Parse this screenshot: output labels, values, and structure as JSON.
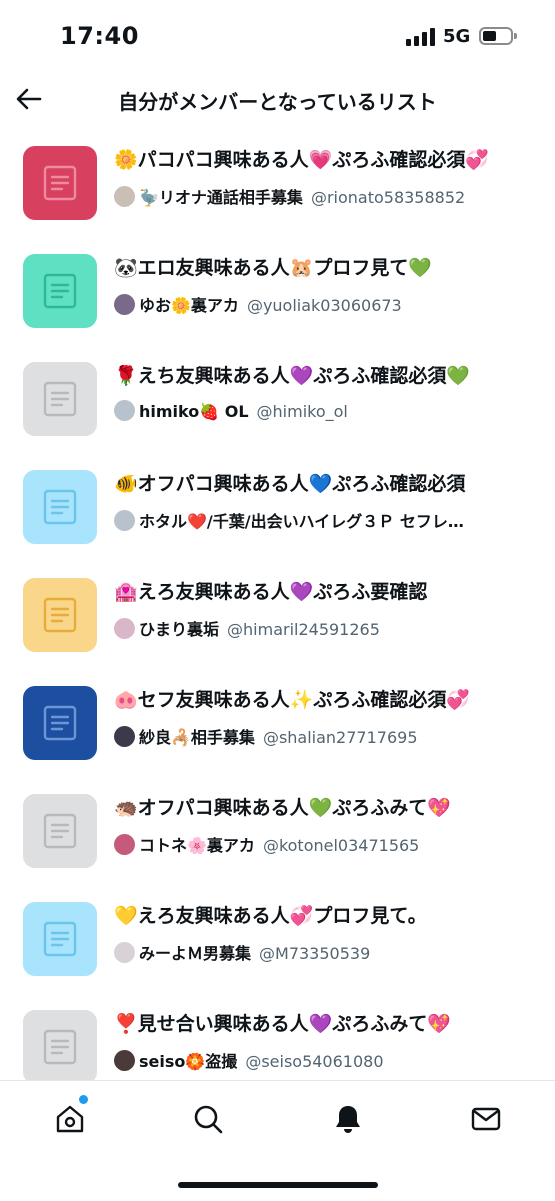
{
  "status": {
    "time": "17:40",
    "network": "5G"
  },
  "header": {
    "title": "自分がメンバーとなっているリスト"
  },
  "lists": [
    {
      "name": "🌼パコパコ興味ある人💗ぷろふ確認必須💞",
      "owner": "🦤リオナ通話相手募集",
      "handle": "@rionato58358852",
      "thumb_color": "#d7405f",
      "icon_color": "#f08aa0",
      "avatar_color": "#c9bfb5"
    },
    {
      "name": "🐼エロ友興味ある人🐹プロフ見て💚",
      "owner": "ゆお🌼裏アカ",
      "handle": "@yuoliak03060673",
      "thumb_color": "#5fe0c2",
      "icon_color": "#2fb896",
      "avatar_color": "#7a6a8a"
    },
    {
      "name": "🌹えち友興味ある人💜ぷろふ確認必須💚",
      "owner": "himiko🍓 OL",
      "handle": "@himiko_ol",
      "thumb_color": "#dddfe0",
      "icon_color": "#b7babd",
      "avatar_color": "#b8c2cc"
    },
    {
      "name": "🐠オフパコ興味ある人💙ぷろふ確認必須",
      "owner": "ホタル❤️/千葉/出会いハイレグ３Ｐ セフレ…",
      "handle": "",
      "thumb_color": "#a8e4fb",
      "icon_color": "#6cc3ec",
      "avatar_color": "#b8c2cc"
    },
    {
      "name": "🏩えろ友興味ある人💜ぷろふ要確認",
      "owner": "ひまり裏垢",
      "handle": "@himaril24591265",
      "thumb_color": "#f9d68a",
      "icon_color": "#e8ac3a",
      "avatar_color": "#d9b7c9"
    },
    {
      "name": "🐽セフ友興味ある人✨ぷろふ確認必須💞",
      "owner": "紗良🦂相手募集",
      "handle": "@shalian27717695",
      "thumb_color": "#1c4fa0",
      "icon_color": "#6e95d6",
      "avatar_color": "#3a3a4a"
    },
    {
      "name": "🦔オフパコ興味ある人💚ぷろふみて💖",
      "owner": "コトネ🌸裏アカ",
      "handle": "@kotonel03471565",
      "thumb_color": "#dddfe0",
      "icon_color": "#b7babd",
      "avatar_color": "#c55a7a"
    },
    {
      "name": "💛えろ友興味ある人💞プロフ見て。",
      "owner": "みーよＭ男募集",
      "handle": "@M73350539",
      "thumb_color": "#a8e4fb",
      "icon_color": "#6cc3ec",
      "avatar_color": "#d8d2d6"
    },
    {
      "name": "❣️見せ合い興味ある人💜ぷろふみて💖",
      "owner": "seiso🏵️盗撮",
      "handle": "@seiso54061080",
      "thumb_color": "#dddfe0",
      "icon_color": "#b7babd",
      "avatar_color": "#4a3a3a"
    }
  ],
  "tabs": [
    {
      "name": "home",
      "icon": "home-icon"
    },
    {
      "name": "search",
      "icon": "search-icon"
    },
    {
      "name": "notifications",
      "icon": "bell-icon"
    },
    {
      "name": "messages",
      "icon": "mail-icon"
    }
  ],
  "colors": {
    "accent": "#1d9bf0",
    "text": "#0f1419",
    "secondary": "#536471"
  }
}
